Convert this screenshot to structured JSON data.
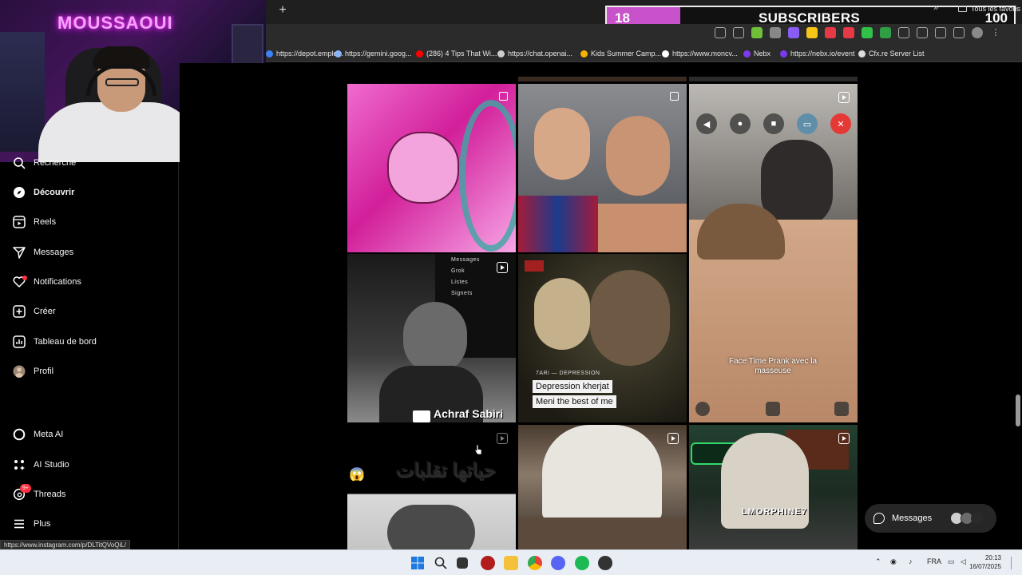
{
  "browser": {
    "new_tab_label": "+",
    "bookmarks": [
      {
        "label": "https://depot.emplo...",
        "color": "#3b82f6"
      },
      {
        "label": "https://gemini.goog...",
        "color": "#8ab4f8"
      },
      {
        "label": "(286) 4 Tips That Wi...",
        "color": "#ff0000"
      },
      {
        "label": "https://chat.openai...",
        "color": "#cccccc"
      },
      {
        "label": "Kids Summer Camp...",
        "color": "#f4b400"
      },
      {
        "label": "https://www.moncv...",
        "color": "#ffffff"
      },
      {
        "label": "Nebx",
        "color": "#7c3aed"
      },
      {
        "label": "https://nebx.io/event",
        "color": "#7c3aed"
      },
      {
        "label": "Cfx.re Server List",
        "color": "#dddddd"
      }
    ],
    "bookmarks_more": "»",
    "all_bookmarks": "Tous les favoris"
  },
  "overlay": {
    "subscriber_count": "18",
    "subscriber_label": "SUBSCRIBERS",
    "subscriber_goal": "100",
    "progress": 0.18,
    "fill_color": "#c752c9"
  },
  "webcam": {
    "neon_sign": "MOUSSAOUI"
  },
  "sidebar": {
    "items": [
      {
        "label": "Recherche",
        "icon": "search-icon"
      },
      {
        "label": "Découvrir",
        "icon": "compass-icon"
      },
      {
        "label": "Reels",
        "icon": "reels-icon"
      },
      {
        "label": "Messages",
        "icon": "send-icon"
      },
      {
        "label": "Notifications",
        "icon": "heart-icon"
      },
      {
        "label": "Créer",
        "icon": "plus-square-icon"
      },
      {
        "label": "Tableau de bord",
        "icon": "dashboard-icon"
      },
      {
        "label": "Profil",
        "icon": "profile-avatar"
      },
      {
        "label": "Meta AI",
        "icon": "meta-ai-icon"
      },
      {
        "label": "AI Studio",
        "icon": "ai-studio-icon"
      },
      {
        "label": "Threads",
        "icon": "threads-icon"
      },
      {
        "label": "Plus",
        "icon": "menu-icon"
      }
    ],
    "threads_badge": "9+"
  },
  "feed": {
    "tiles": [
      {
        "name": "post-anime",
        "kind": "carousel"
      },
      {
        "name": "post-football-selfie",
        "kind": "carousel"
      },
      {
        "name": "post-facetime-prank",
        "kind": "reel",
        "caption": "Face Time Prank avec la masseuse"
      },
      {
        "name": "post-streamer",
        "kind": "reel",
        "caption": "Achraf Sabiri",
        "menu": [
          "Messages",
          "Grok",
          "Listes",
          "Signets"
        ]
      },
      {
        "name": "post-depression-meme",
        "kind": "reel",
        "tag": "7ARi — DEPRESSION",
        "line1": "Depression kherjat",
        "line2": "Meni the best of me"
      },
      {
        "name": "post-arabic-text",
        "kind": "reel",
        "caption": "حياتها تقلبات"
      },
      {
        "name": "post-white-tshirt",
        "kind": "reel"
      },
      {
        "name": "post-gamer-clips",
        "kind": "reel",
        "caption": "LMORPHINE7"
      }
    ]
  },
  "messages_pill": {
    "label": "Messages"
  },
  "status_url": "https://www.instagram.com/p/DLTitQVoQiL/",
  "taskbar": {
    "language": "FRA",
    "time": "20:13",
    "date": "16/07/2025"
  }
}
